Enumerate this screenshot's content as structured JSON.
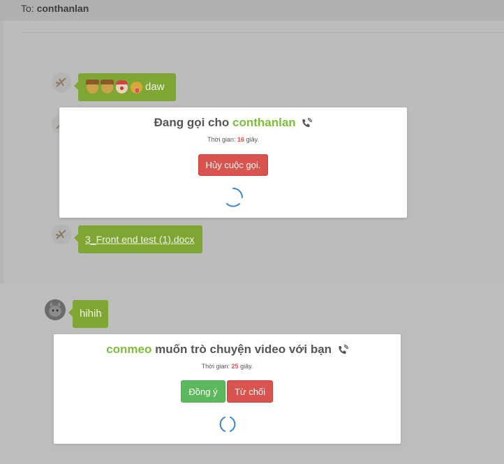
{
  "header": {
    "to_prefix": "To:",
    "recipient": "conthanlan"
  },
  "messages": [
    {
      "emoji_icons": [
        "cowboy-face-icon",
        "cowboy-face-icon",
        "clown-face-icon",
        "zany-face-icon"
      ],
      "text": "daw"
    },
    {
      "file_name": "3_Front end test (1).docx"
    },
    {
      "text": "hihih"
    }
  ],
  "outgoing_call": {
    "title_prefix": "Đang gọi cho",
    "callee": "conthanlan",
    "icon": "phone-ringing-icon",
    "time_label": "Thời gian:",
    "time_value": "16",
    "time_unit": "giây.",
    "cancel_label": "Hủy cuộc gọi."
  },
  "incoming_call": {
    "caller": "conmeo",
    "title_suffix": "muốn trò chuyện video với bạn",
    "icon": "phone-ringing-icon",
    "time_label": "Thời gian:",
    "time_value": "25",
    "time_unit": "giây.",
    "accept_label": "Đồng ý",
    "reject_label": "Từ chối"
  },
  "colors": {
    "bubble": "#7fa635",
    "accent_green": "#7ebd3a",
    "danger": "#d9534f",
    "success": "#5cb85c"
  }
}
